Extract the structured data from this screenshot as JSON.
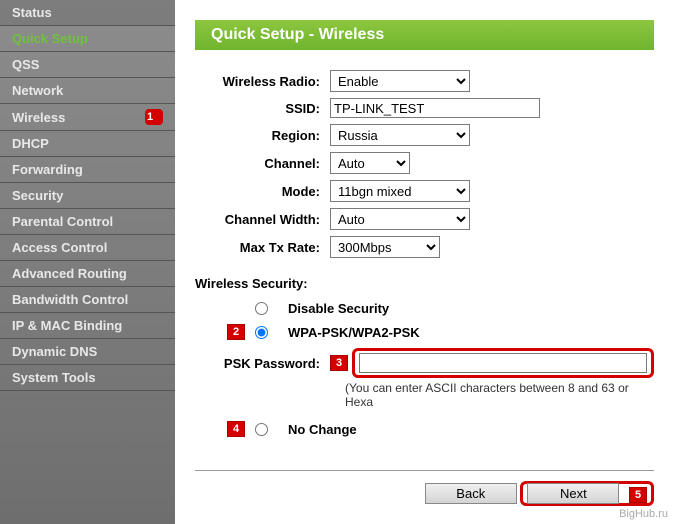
{
  "sidebar": {
    "items": [
      {
        "label": "Status"
      },
      {
        "label": "Quick Setup"
      },
      {
        "label": "QSS"
      },
      {
        "label": "Network"
      },
      {
        "label": "Wireless"
      },
      {
        "label": "DHCP"
      },
      {
        "label": "Forwarding"
      },
      {
        "label": "Security"
      },
      {
        "label": "Parental Control"
      },
      {
        "label": "Access Control"
      },
      {
        "label": "Advanced Routing"
      },
      {
        "label": "Bandwidth Control"
      },
      {
        "label": "IP & MAC Binding"
      },
      {
        "label": "Dynamic DNS"
      },
      {
        "label": "System Tools"
      }
    ]
  },
  "header": {
    "title": "Quick Setup - Wireless"
  },
  "form": {
    "wireless_radio_label": "Wireless Radio:",
    "wireless_radio_value": "Enable",
    "ssid_label": "SSID:",
    "ssid_value": "TP-LINK_TEST",
    "region_label": "Region:",
    "region_value": "Russia",
    "channel_label": "Channel:",
    "channel_value": "Auto",
    "mode_label": "Mode:",
    "mode_value": "11bgn mixed",
    "channel_width_label": "Channel Width:",
    "channel_width_value": "Auto",
    "max_tx_label": "Max Tx Rate:",
    "max_tx_value": "300Mbps"
  },
  "security": {
    "section_label": "Wireless Security:",
    "disable_label": "Disable Security",
    "wpa_label": "WPA-PSK/WPA2-PSK",
    "psk_label": "PSK Password:",
    "psk_value": "",
    "hint": "(You can enter ASCII characters between 8 and 63 or Hexa",
    "nochange_label": "No Change"
  },
  "buttons": {
    "back": "Back",
    "next": "Next"
  },
  "markers": {
    "m1": "1",
    "m2": "2",
    "m3": "3",
    "m4": "4",
    "m5": "5"
  },
  "watermark": "BigHub.ru"
}
